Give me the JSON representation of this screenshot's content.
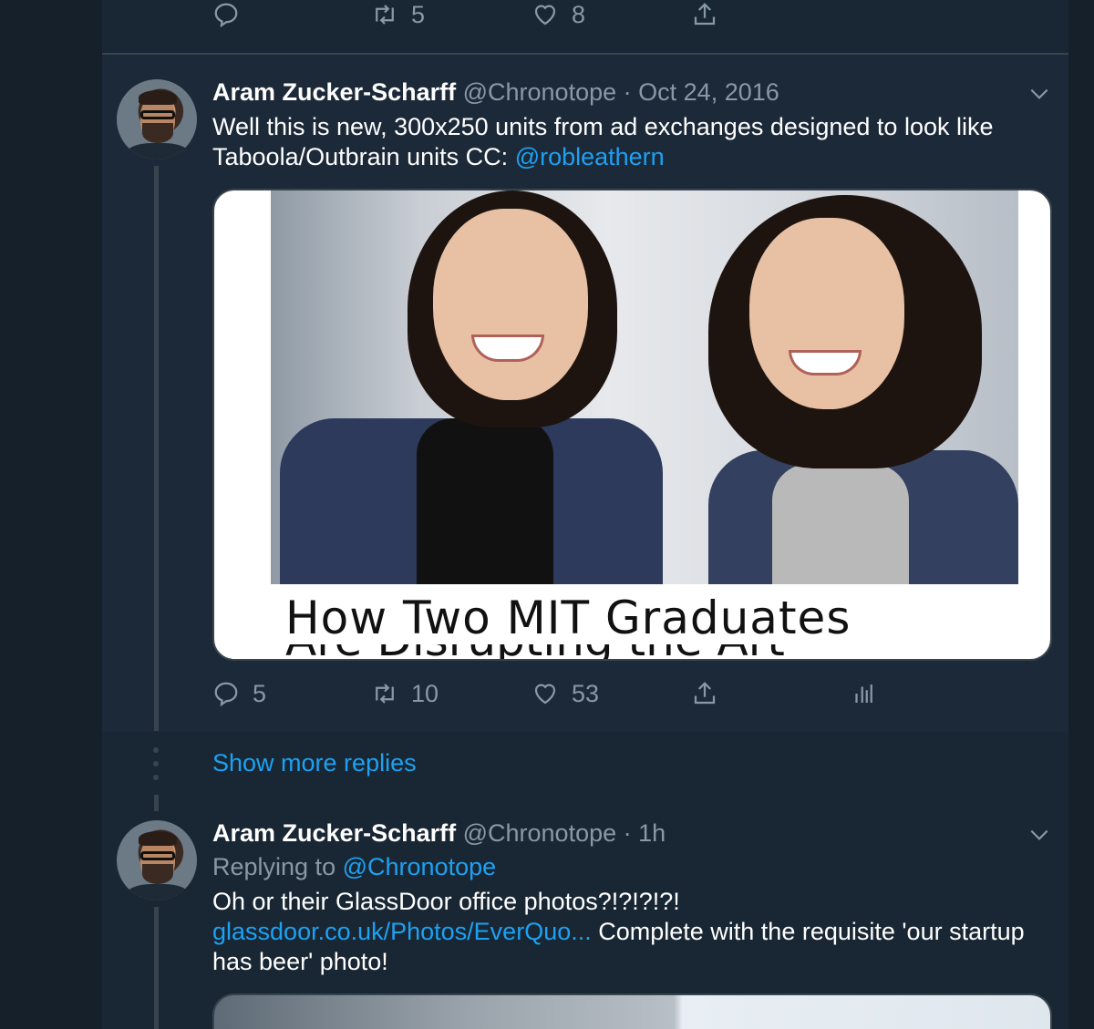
{
  "colors": {
    "background": "#15202b",
    "feed": "#192734",
    "highlight": "#1c2938",
    "muted": "#8899a6",
    "accent": "#1da1f2",
    "border": "#38444d"
  },
  "top_actions": {
    "reply_icon": "reply-icon",
    "retweet_icon": "retweet-icon",
    "retweet_count": "5",
    "like_icon": "heart-icon",
    "like_count": "8",
    "share_icon": "share-icon"
  },
  "tweet1": {
    "author_name": "Aram Zucker-Scharff",
    "handle": "@Chronotope",
    "separator": "·",
    "date": "Oct 24, 2016",
    "text_line1": "Well this is new, 300x250 units from ad exchanges designed to look like",
    "text_line2": "Taboola/Outbrain units CC:",
    "mention": "@robleathern",
    "media_caption": "How Two MIT Graduates",
    "media_caption_cut": "Are Disrupting the Art",
    "reply_count": "5",
    "retweet_count": "10",
    "like_count": "53",
    "analytics_icon": "analytics-icon"
  },
  "show_more": "Show more replies",
  "tweet2": {
    "author_name": "Aram Zucker-Scharff",
    "handle": "@Chronotope",
    "separator": "·",
    "time": "1h",
    "replying_label": "Replying to",
    "replying_handle": "@Chronotope",
    "text_line1": "Oh or their GlassDoor office photos?!?!?!?!",
    "link": "glassdoor.co.uk/Photos/EverQuo...",
    "text_line2_rest": " Complete with the requisite 'our startup",
    "text_line3": "has beer' photo!"
  }
}
